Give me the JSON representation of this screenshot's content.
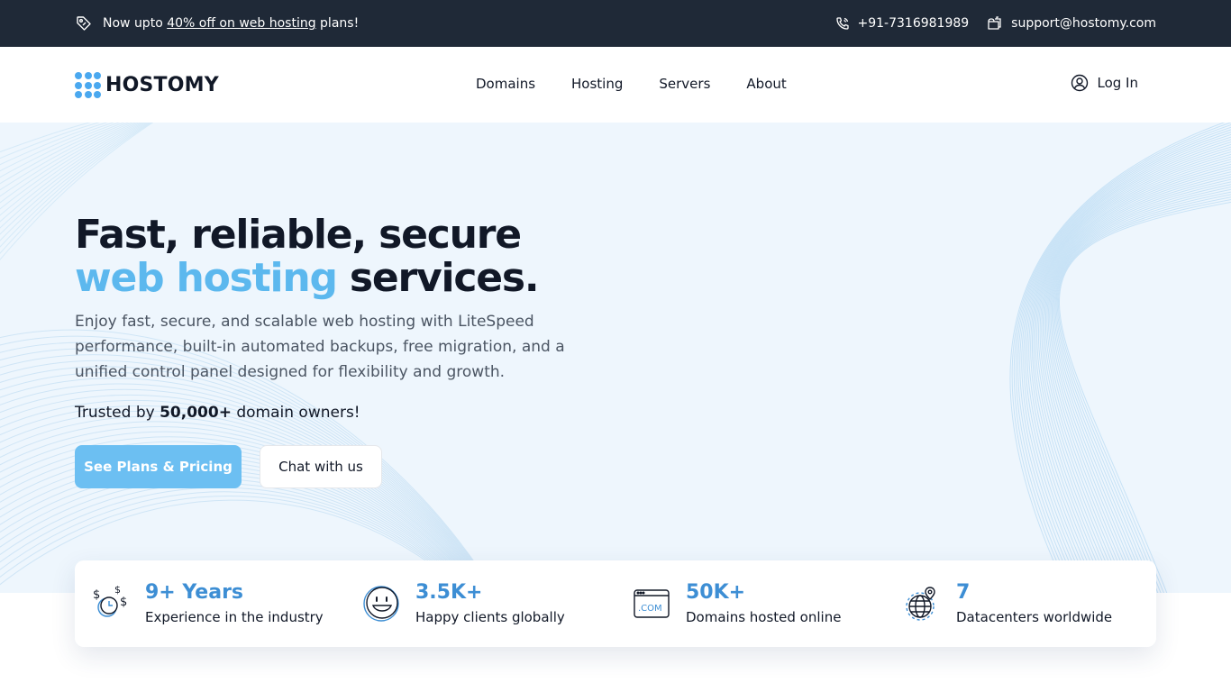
{
  "topbar": {
    "promo_prefix": "Now upto ",
    "promo_link": "40% off on web hosting",
    "promo_suffix": " plans!",
    "phone": "+91-7316981989",
    "email": "support@hostomy.com"
  },
  "header": {
    "logo_text": "HOSTOMY",
    "nav": [
      "Domains",
      "Hosting",
      "Servers",
      "About"
    ],
    "login_label": "Log In"
  },
  "hero": {
    "headline_line1": "Fast, reliable, secure",
    "headline_accent": "web hosting",
    "headline_rest": " services.",
    "subtext": "Enjoy fast, secure, and scalable web hosting with LiteSpeed performance, built-in automated backups, free migration, and a unified control panel designed for flexibility and growth.",
    "trusted_prefix": "Trusted by ",
    "trusted_count": "50,000+",
    "trusted_suffix": " domain owners!",
    "primary_button": "See Plans & Pricing",
    "secondary_button": "Chat with us"
  },
  "stats": [
    {
      "value": "9+ Years",
      "label": "Experience in the industry",
      "icon": "money-clock-icon"
    },
    {
      "value": "3.5K+",
      "label": "Happy clients globally",
      "icon": "smiley-icon"
    },
    {
      "value": "50K+",
      "label": "Domains hosted online",
      "icon": "domain-com-icon"
    },
    {
      "value": "7",
      "label": "Datacenters worldwide",
      "icon": "globe-pin-icon"
    }
  ],
  "colors": {
    "topbar_bg": "#1f2937",
    "accent": "#5cb8ee",
    "primary_button": "#6cbff2",
    "stat_value": "#3d8ed4",
    "hero_bg": "#eef6fd"
  }
}
